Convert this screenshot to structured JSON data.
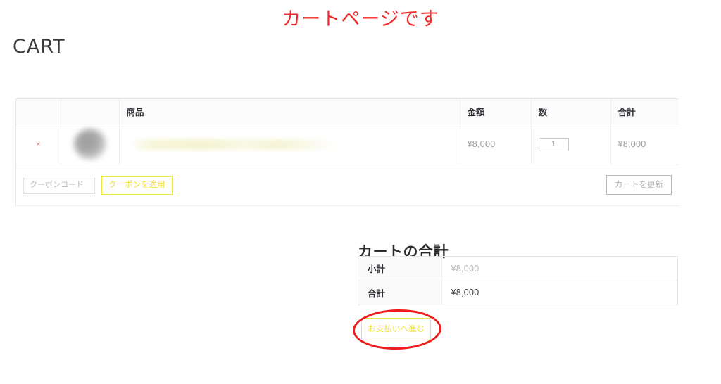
{
  "header": {
    "annotation_title": "カートページです",
    "page_heading": "CART",
    "annotation_color": "#ee2b2b"
  },
  "cart_table": {
    "columns": [
      "",
      "",
      "商品",
      "金額",
      "数",
      "合計"
    ],
    "rows": [
      {
        "remove_label": "×",
        "thumbnail": "blurred-product-image",
        "product_name": "",
        "price": "¥8,000",
        "quantity": "1",
        "line_total": "¥8,000"
      }
    ],
    "coupon": {
      "placeholder": "クーポンコード",
      "value": "",
      "apply_label": "クーポンを適用",
      "update_label": "カートを更新"
    }
  },
  "cart_totals": {
    "title": "カートの合計",
    "rows": [
      {
        "label": "小計",
        "value": "¥8,000"
      },
      {
        "label": "合計",
        "value": "¥8,000"
      }
    ],
    "checkout_label": "お支払いへ進む"
  },
  "theme": {
    "accent_yellow": "#f0e44a",
    "annotation_red": "#ee1c1c",
    "text_dark": "#3c3c3c",
    "text_muted": "#9a9a9a",
    "border_gray": "#e6e6e6"
  }
}
